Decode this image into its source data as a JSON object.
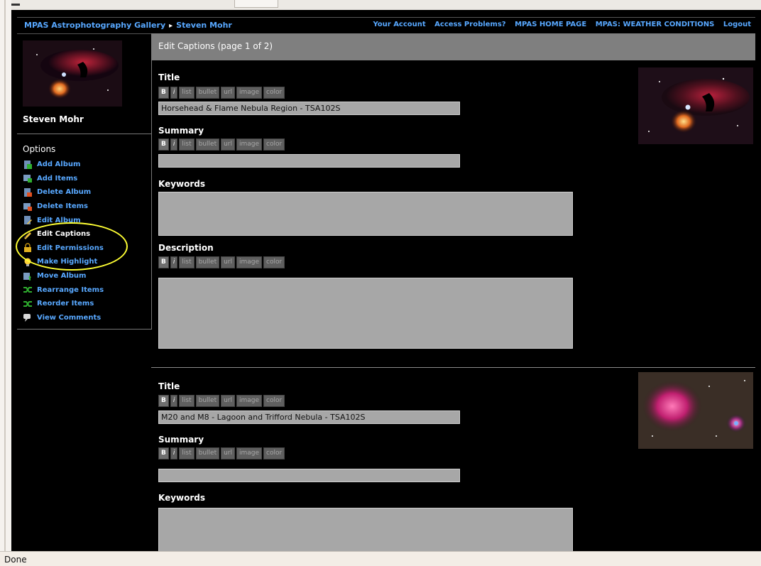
{
  "header": {
    "breadcrumb": [
      "MPAS Astrophotography Gallery",
      "Steven Mohr"
    ],
    "breadcrumb_separator": "▸",
    "links": [
      "Your Account",
      "Access Problems?",
      "MPAS HOME PAGE",
      "MPAS: WEATHER CONDITIONS",
      "Logout"
    ]
  },
  "sidebar": {
    "owner": "Steven Mohr",
    "options_title": "Options",
    "items": [
      {
        "label": "Add Album",
        "icon": "add-album-icon"
      },
      {
        "label": "Add Items",
        "icon": "add-items-icon"
      },
      {
        "label": "Delete Album",
        "icon": "delete-album-icon"
      },
      {
        "label": "Delete Items",
        "icon": "delete-items-icon"
      },
      {
        "label": "Edit Album",
        "icon": "edit-album-icon"
      },
      {
        "label": "Edit Captions",
        "icon": "pencil-icon",
        "current": true
      },
      {
        "label": "Edit Permissions",
        "icon": "lock-icon"
      },
      {
        "label": "Make Highlight",
        "icon": "lightbulb-icon"
      },
      {
        "label": "Move Album",
        "icon": "move-album-icon"
      },
      {
        "label": "Rearrange Items",
        "icon": "shuffle-icon"
      },
      {
        "label": "Reorder Items",
        "icon": "shuffle-icon"
      },
      {
        "label": "View Comments",
        "icon": "comment-icon"
      }
    ]
  },
  "main": {
    "header": "Edit Captions (page 1 of 2)",
    "field_labels": {
      "title": "Title",
      "summary": "Summary",
      "keywords": "Keywords",
      "description": "Description"
    },
    "toolbar_buttons": [
      "B",
      "i",
      "list",
      "bullet",
      "url",
      "image",
      "color"
    ],
    "items": [
      {
        "title": "Horsehead & Flame Nebula Region - TSA102S",
        "summary": "",
        "keywords": "",
        "description": ""
      },
      {
        "title": "M20 and M8 - Lagoon and Trifford Nebula - TSA102S",
        "summary": "",
        "keywords": ""
      }
    ]
  },
  "status": "Done",
  "colors": {
    "link": "#58a8ff",
    "highlight_ring": "#ffff33",
    "field_bg": "#a7a7a7",
    "header_bg": "#7f7f7f"
  }
}
